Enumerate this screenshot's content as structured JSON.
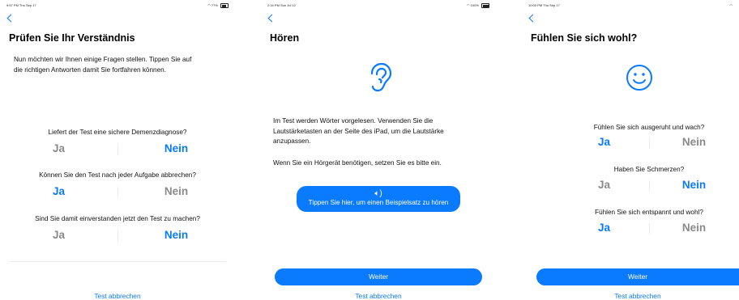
{
  "screen1": {
    "status_time": "9:57 PM  Thu Sep 17",
    "status_battery": "77%",
    "title": "Prüfen Sie Ihr Verständnis",
    "intro_line1": "Nun möchten wir Ihnen einige Fragen stellen. Tippen Sie auf",
    "intro_line2": "die richtigen Antworten damit Sie fortfahren können.",
    "questions": [
      {
        "text": "Liefert der Test eine sichere Demenzdiagnose?",
        "yes": "Ja",
        "no": "Nein",
        "selected": "no"
      },
      {
        "text": "Können Sie den Test nach jeder Aufgabe abbrechen?",
        "yes": "Ja",
        "no": "Nein",
        "selected": "yes"
      },
      {
        "text": "Sind Sie damit einverstanden jetzt den Test zu machen?",
        "yes": "Ja",
        "no": "Nein",
        "selected": "no"
      }
    ],
    "cancel_label": "Test abbrechen"
  },
  "screen2": {
    "status_time": "2:16 PM  Sun Jul 12",
    "status_battery": "100%",
    "title": "Hören",
    "icon": "ear-icon",
    "para1_line1": "Im Test werden Wörter vorgelesen. Verwenden Sie die",
    "para1_line2": "Lautstärketasten an der Seite des iPad, um die Lautstärke",
    "para1_line3": "anzupassen.",
    "para2": "Wenn Sie ein Hörgerät benötigen, setzen Sie es bitte ein.",
    "sample_button": "Tippen Sie hier, um einen Beispielsatz zu hören",
    "next_label": "Weiter",
    "cancel_label": "Test abbrechen"
  },
  "screen3": {
    "status_time": "10:00 PM  Thu Sep 17",
    "title": "Fühlen Sie sich wohl?",
    "icon": "smiley-face-icon",
    "questions": [
      {
        "text": "Fühlen Sie sich ausgeruht und wach?",
        "yes": "Ja",
        "no": "Nein",
        "selected": "yes"
      },
      {
        "text": "Haben Sie Schmerzen?",
        "yes": "Ja",
        "no": "Nein",
        "selected": "no"
      },
      {
        "text": "Fühlen Sie sich entspannt und wohl?",
        "yes": "Ja",
        "no": "Nein",
        "selected": "yes"
      }
    ],
    "next_label": "Weiter",
    "cancel_label": "Test abbrechen"
  },
  "colors": {
    "accent": "#0a7aff",
    "unselected": "#8a8a8a"
  }
}
